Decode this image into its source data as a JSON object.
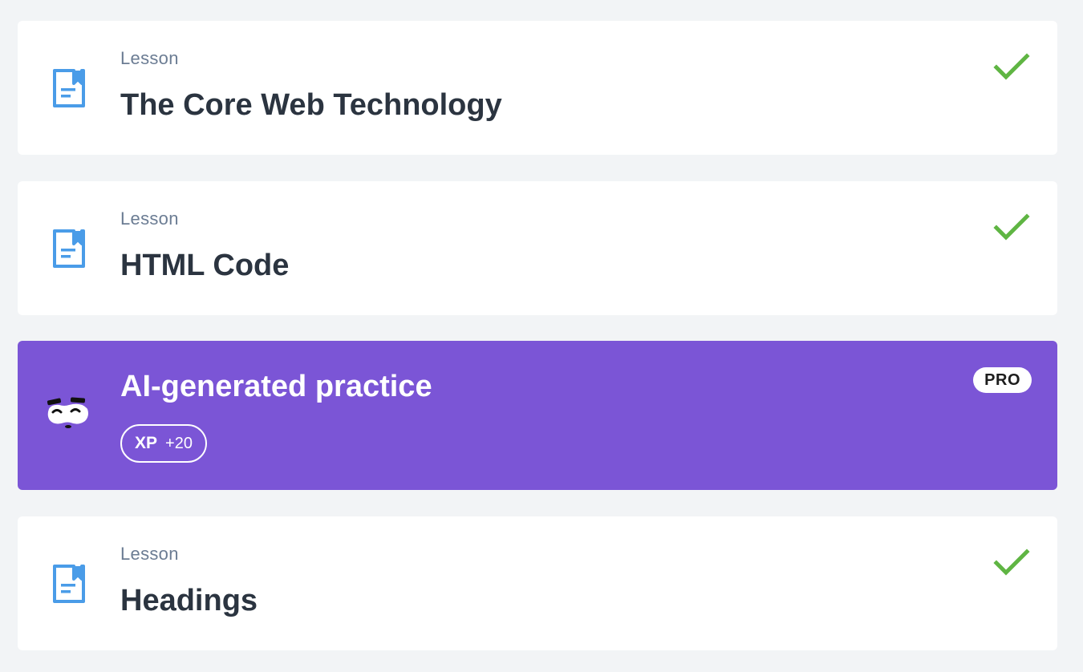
{
  "colors": {
    "page_background": "#f2f4f6",
    "card_background": "#ffffff",
    "practice_background": "#7b55d6",
    "icon_blue": "#4a9ce8",
    "check_green": "#5fb543",
    "title_text": "#2b3440",
    "kicker_text": "#6b7c93"
  },
  "items": [
    {
      "kicker": "Lesson",
      "title": "The Core Web Technology",
      "icon": "lesson-document-icon",
      "status_icon": "checkmark-icon",
      "completed": true
    },
    {
      "kicker": "Lesson",
      "title": "HTML Code",
      "icon": "lesson-document-icon",
      "status_icon": "checkmark-icon",
      "completed": true
    },
    {
      "title": "AI-generated practice",
      "icon": "ai-mascot-icon",
      "badge": "PRO",
      "xp_label": "XP",
      "xp_value": "+20"
    },
    {
      "kicker": "Lesson",
      "title": "Headings",
      "icon": "lesson-document-icon",
      "status_icon": "checkmark-icon",
      "completed": true
    }
  ]
}
